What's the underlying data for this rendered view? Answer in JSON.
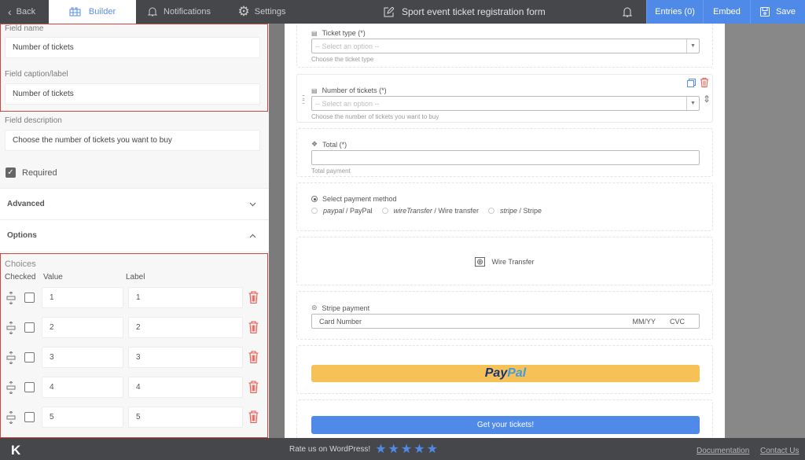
{
  "topbar": {
    "back_label": "Back",
    "tabs": [
      {
        "label": "Builder",
        "icon": "builder-icon",
        "active": true
      },
      {
        "label": "Notifications",
        "icon": "bell-icon",
        "active": false
      },
      {
        "label": "Settings",
        "icon": "gear-icon",
        "active": false
      }
    ],
    "form_title": "Sport event ticket registration form",
    "entries_label": "Entries (0)",
    "embed_label": "Embed",
    "save_label": "Save",
    "accent_color": "#4f8ae8"
  },
  "left_panel": {
    "field_name_label": "Field name",
    "field_name_value": "Number of tickets",
    "field_caption_label": "Field caption/label",
    "field_caption_value": "Number of tickets",
    "field_description_label": "Field description",
    "field_description_value": "Choose the number of tickets you want to buy",
    "required_label": "Required",
    "required_checked": true,
    "advanced_label": "Advanced",
    "options_label": "Options",
    "choices": {
      "title": "Choices",
      "headers": {
        "checked": "Checked",
        "value": "Value",
        "label": "Label"
      },
      "rows": [
        {
          "checked": false,
          "value": "1",
          "label": "1"
        },
        {
          "checked": false,
          "value": "2",
          "label": "2"
        },
        {
          "checked": false,
          "value": "3",
          "label": "3"
        },
        {
          "checked": false,
          "value": "4",
          "label": "4"
        },
        {
          "checked": false,
          "value": "5",
          "label": "5"
        }
      ]
    }
  },
  "canvas": {
    "ticket_type": {
      "label": "Ticket type (*)",
      "placeholder": "-- Select an option --",
      "help": "Choose the ticket type"
    },
    "num_tickets": {
      "label": "Number of tickets (*)",
      "placeholder": "-- Select an option --",
      "help": "Choose the number of tickets you want to buy"
    },
    "total": {
      "label": "Total (*)",
      "value": "",
      "help": "Total payment"
    },
    "payment_method": {
      "label": "Select payment method",
      "options": [
        {
          "key": "paypal",
          "label": "PayPal"
        },
        {
          "key": "wireTransfer",
          "label": "Wire transfer"
        },
        {
          "key": "stripe",
          "label": "Stripe"
        }
      ]
    },
    "wire_transfer_label": "Wire Transfer",
    "stripe": {
      "label": "Stripe payment",
      "card_number": "Card Number",
      "expiry": "MM/YY",
      "cvc": "CVC"
    },
    "paypal": {
      "pay": "Pay",
      "pal": "Pal"
    },
    "submit_label": "Get your tickets!"
  },
  "footer": {
    "logo": "K",
    "rate_label": "Rate us on WordPress!",
    "stars": 5,
    "documentation": "Documentation",
    "contact": "Contact Us"
  }
}
